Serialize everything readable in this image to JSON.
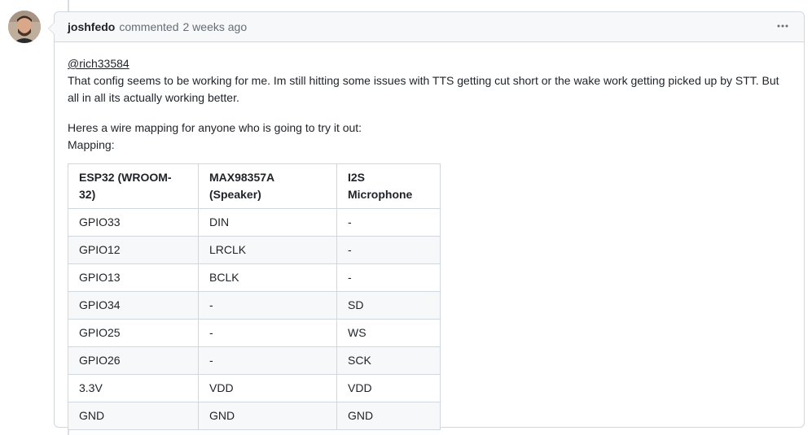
{
  "comment": {
    "author": "joshfedo",
    "action": "commented",
    "time": "2 weeks ago",
    "menu_icon": "kebab-horizontal-icon",
    "mention": "@rich33584",
    "paragraph1": "That config seems to be working for me. Im still hitting some issues with TTS getting cut short or the wake work getting picked up by STT. But all in all its actually working better.",
    "line2a": "Heres a wire mapping for anyone who is going to try it out:",
    "line2b": "Mapping:"
  },
  "table": {
    "headers": [
      "ESP32 (WROOM-32)",
      "MAX98357A (Speaker)",
      "I2S Microphone"
    ],
    "rows": [
      [
        "GPIO33",
        "DIN",
        "-"
      ],
      [
        "GPIO12",
        "LRCLK",
        "-"
      ],
      [
        "GPIO13",
        "BCLK",
        "-"
      ],
      [
        "GPIO34",
        "-",
        "SD"
      ],
      [
        "GPIO25",
        "-",
        "WS"
      ],
      [
        "GPIO26",
        "-",
        "SCK"
      ],
      [
        "3.3V",
        "VDD",
        "VDD"
      ],
      [
        "GND",
        "GND",
        "GND"
      ]
    ]
  }
}
